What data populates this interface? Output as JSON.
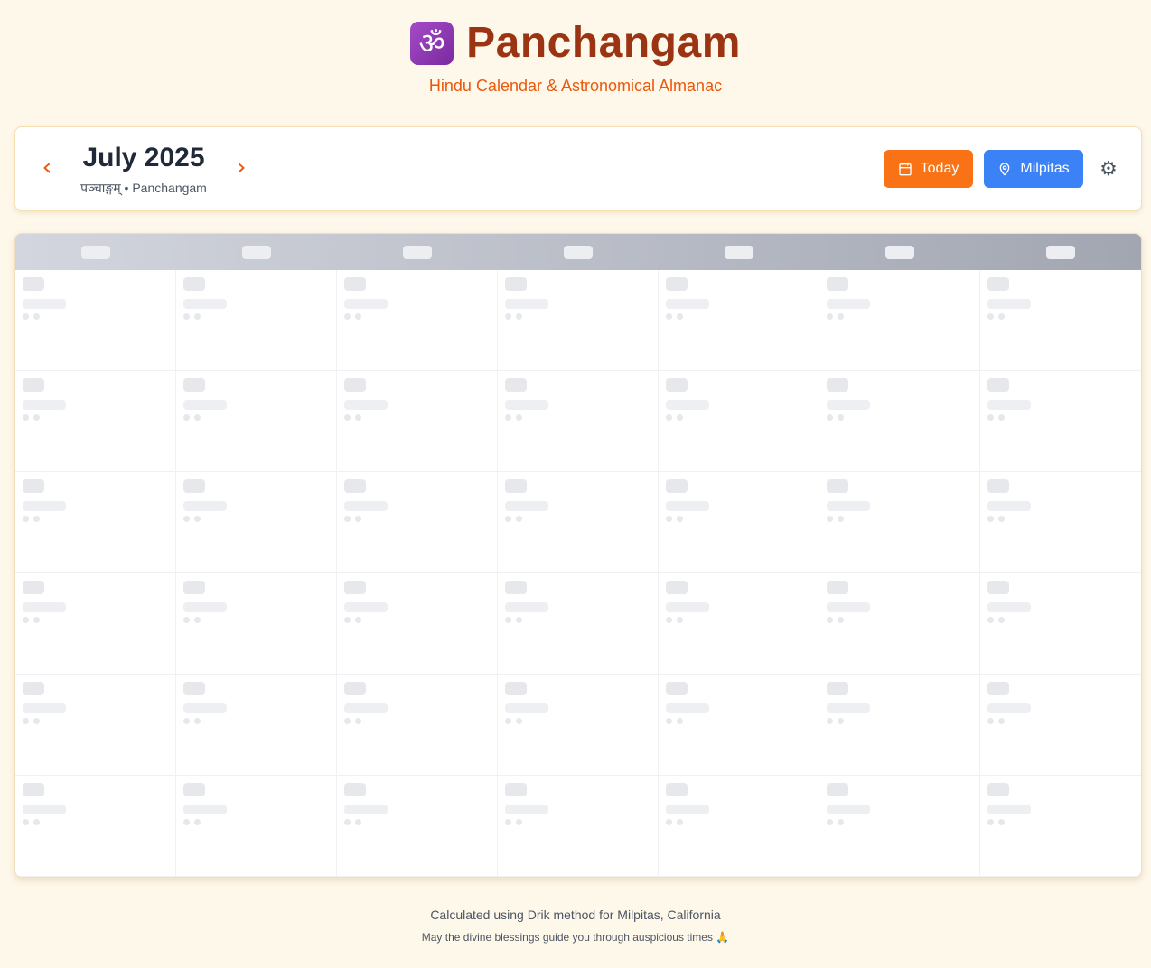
{
  "header": {
    "icon": "om-icon",
    "icon_glyph": "ॐ",
    "title": "Panchangam",
    "subtitle": "Hindu Calendar & Astronomical Almanac"
  },
  "nav": {
    "prev_icon": "chevron-left-icon",
    "prev_glyph": "‹",
    "next_icon": "chevron-right-icon",
    "next_glyph": "›",
    "month_title": "July 2025",
    "month_subtitle": "पञ्चाङ्गम् • Panchangam",
    "today_label": "Today",
    "today_icon": "calendar-icon",
    "location_label": "Milpitas",
    "location_icon": "map-pin-icon",
    "settings_icon": "gear-icon",
    "settings_glyph": "⚙"
  },
  "calendar": {
    "state": "loading",
    "weekday_count": 7,
    "week_rows": 6
  },
  "footer": {
    "line1": "Calculated using Drik method for Milpitas, California",
    "line2": "May the divine blessings guide you through auspicious times 🙏"
  },
  "colors": {
    "background": "#fef8ea",
    "title": "#9a3412",
    "accent_orange": "#f97316",
    "accent_blue": "#3b82f6",
    "skeleton": "#e7e8ec"
  }
}
